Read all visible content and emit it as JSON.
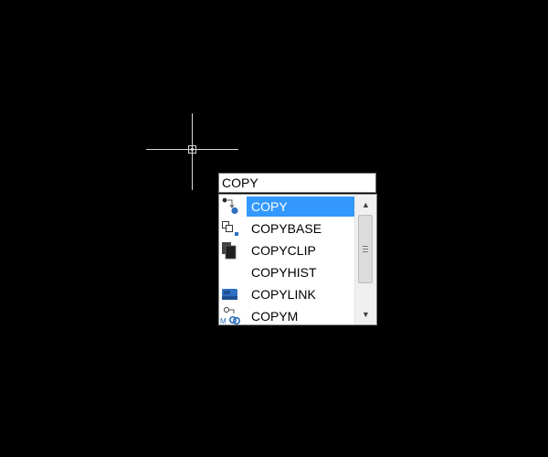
{
  "command_line": {
    "input_value": "COPY"
  },
  "suggestions": {
    "items": [
      {
        "label": "COPY",
        "icon": "copy-icon",
        "selected": true
      },
      {
        "label": "COPYBASE",
        "icon": "copybase-icon",
        "selected": false
      },
      {
        "label": "COPYCLIP",
        "icon": "copyclip-icon",
        "selected": false
      },
      {
        "label": "COPYHIST",
        "icon": "",
        "selected": false
      },
      {
        "label": "COPYLINK",
        "icon": "copylink-icon",
        "selected": false
      },
      {
        "label": "COPYM",
        "icon": "copym-icon",
        "selected": false
      }
    ]
  },
  "colors": {
    "background": "#000000",
    "selection": "#3399ff",
    "icon_blue": "#2f6fbf"
  }
}
